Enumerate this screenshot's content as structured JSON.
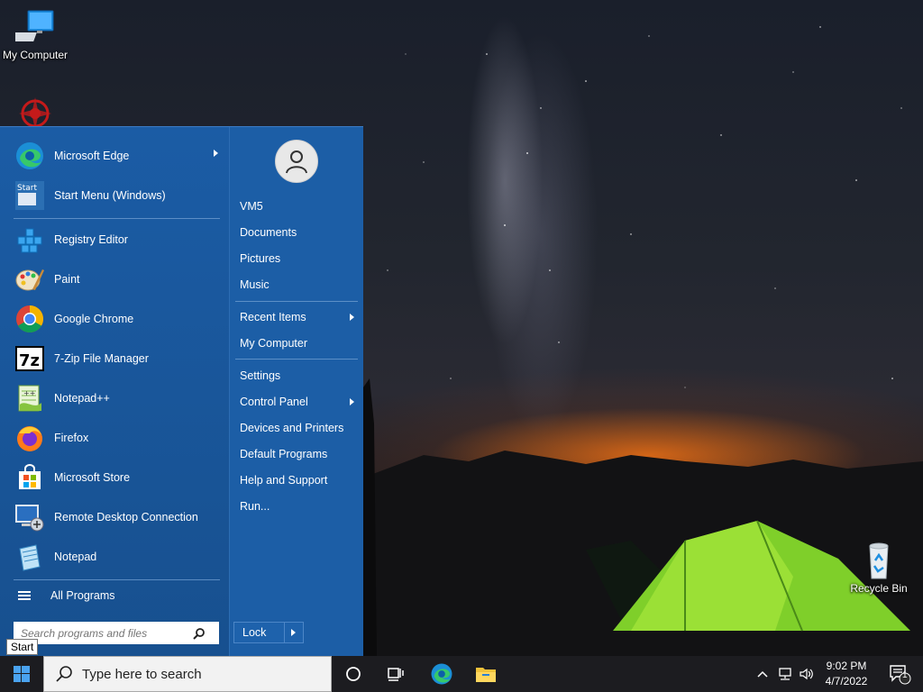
{
  "desktop": {
    "icons": [
      {
        "label": "My Computer",
        "icon": "monitor-icon"
      },
      {
        "label": "",
        "icon": "red-star-logo-icon"
      },
      {
        "label": "Recycle Bin",
        "icon": "recycle-bin-icon"
      }
    ]
  },
  "start_menu": {
    "programs": [
      {
        "label": "Microsoft Edge",
        "icon": "edge-icon",
        "has_submenu": true
      },
      {
        "label": "Start Menu (Windows)",
        "icon": "start-menu-app-icon",
        "has_submenu": false
      },
      {
        "label": "Registry Editor",
        "icon": "registry-icon",
        "has_submenu": false
      },
      {
        "label": "Paint",
        "icon": "paint-icon",
        "has_submenu": false
      },
      {
        "label": "Google Chrome",
        "icon": "chrome-icon",
        "has_submenu": false
      },
      {
        "label": "7-Zip File Manager",
        "icon": "7zip-icon",
        "has_submenu": false
      },
      {
        "label": "Notepad++",
        "icon": "notepad-plus-plus-icon",
        "has_submenu": false
      },
      {
        "label": "Firefox",
        "icon": "firefox-icon",
        "has_submenu": false
      },
      {
        "label": "Microsoft Store",
        "icon": "store-icon",
        "has_submenu": false
      },
      {
        "label": "Remote Desktop Connection",
        "icon": "remote-desktop-icon",
        "has_submenu": false
      },
      {
        "label": "Notepad",
        "icon": "notepad-icon",
        "has_submenu": false
      }
    ],
    "all_programs_label": "All Programs",
    "search_placeholder": "Search programs and files",
    "user_name": "VM5",
    "right_items": [
      {
        "label": "VM5",
        "has_submenu": false
      },
      {
        "label": "Documents",
        "has_submenu": false
      },
      {
        "label": "Pictures",
        "has_submenu": false
      },
      {
        "label": "Music",
        "has_submenu": false
      },
      {
        "label": "Recent Items",
        "has_submenu": true
      },
      {
        "label": "My Computer",
        "has_submenu": false
      },
      {
        "label": "Settings",
        "has_submenu": false
      },
      {
        "label": "Control Panel",
        "has_submenu": true
      },
      {
        "label": "Devices and Printers",
        "has_submenu": false
      },
      {
        "label": "Default Programs",
        "has_submenu": false
      },
      {
        "label": "Help and Support",
        "has_submenu": false
      },
      {
        "label": "Run...",
        "has_submenu": false
      }
    ],
    "lock_label": "Lock",
    "tooltip": "Start"
  },
  "taskbar": {
    "search_placeholder": "Type here to search",
    "time": "9:02 PM",
    "date": "4/7/2022",
    "notification_count": "1"
  },
  "colors": {
    "menu_blue": "#1a5aa2",
    "taskbar": "#1c1c20"
  }
}
